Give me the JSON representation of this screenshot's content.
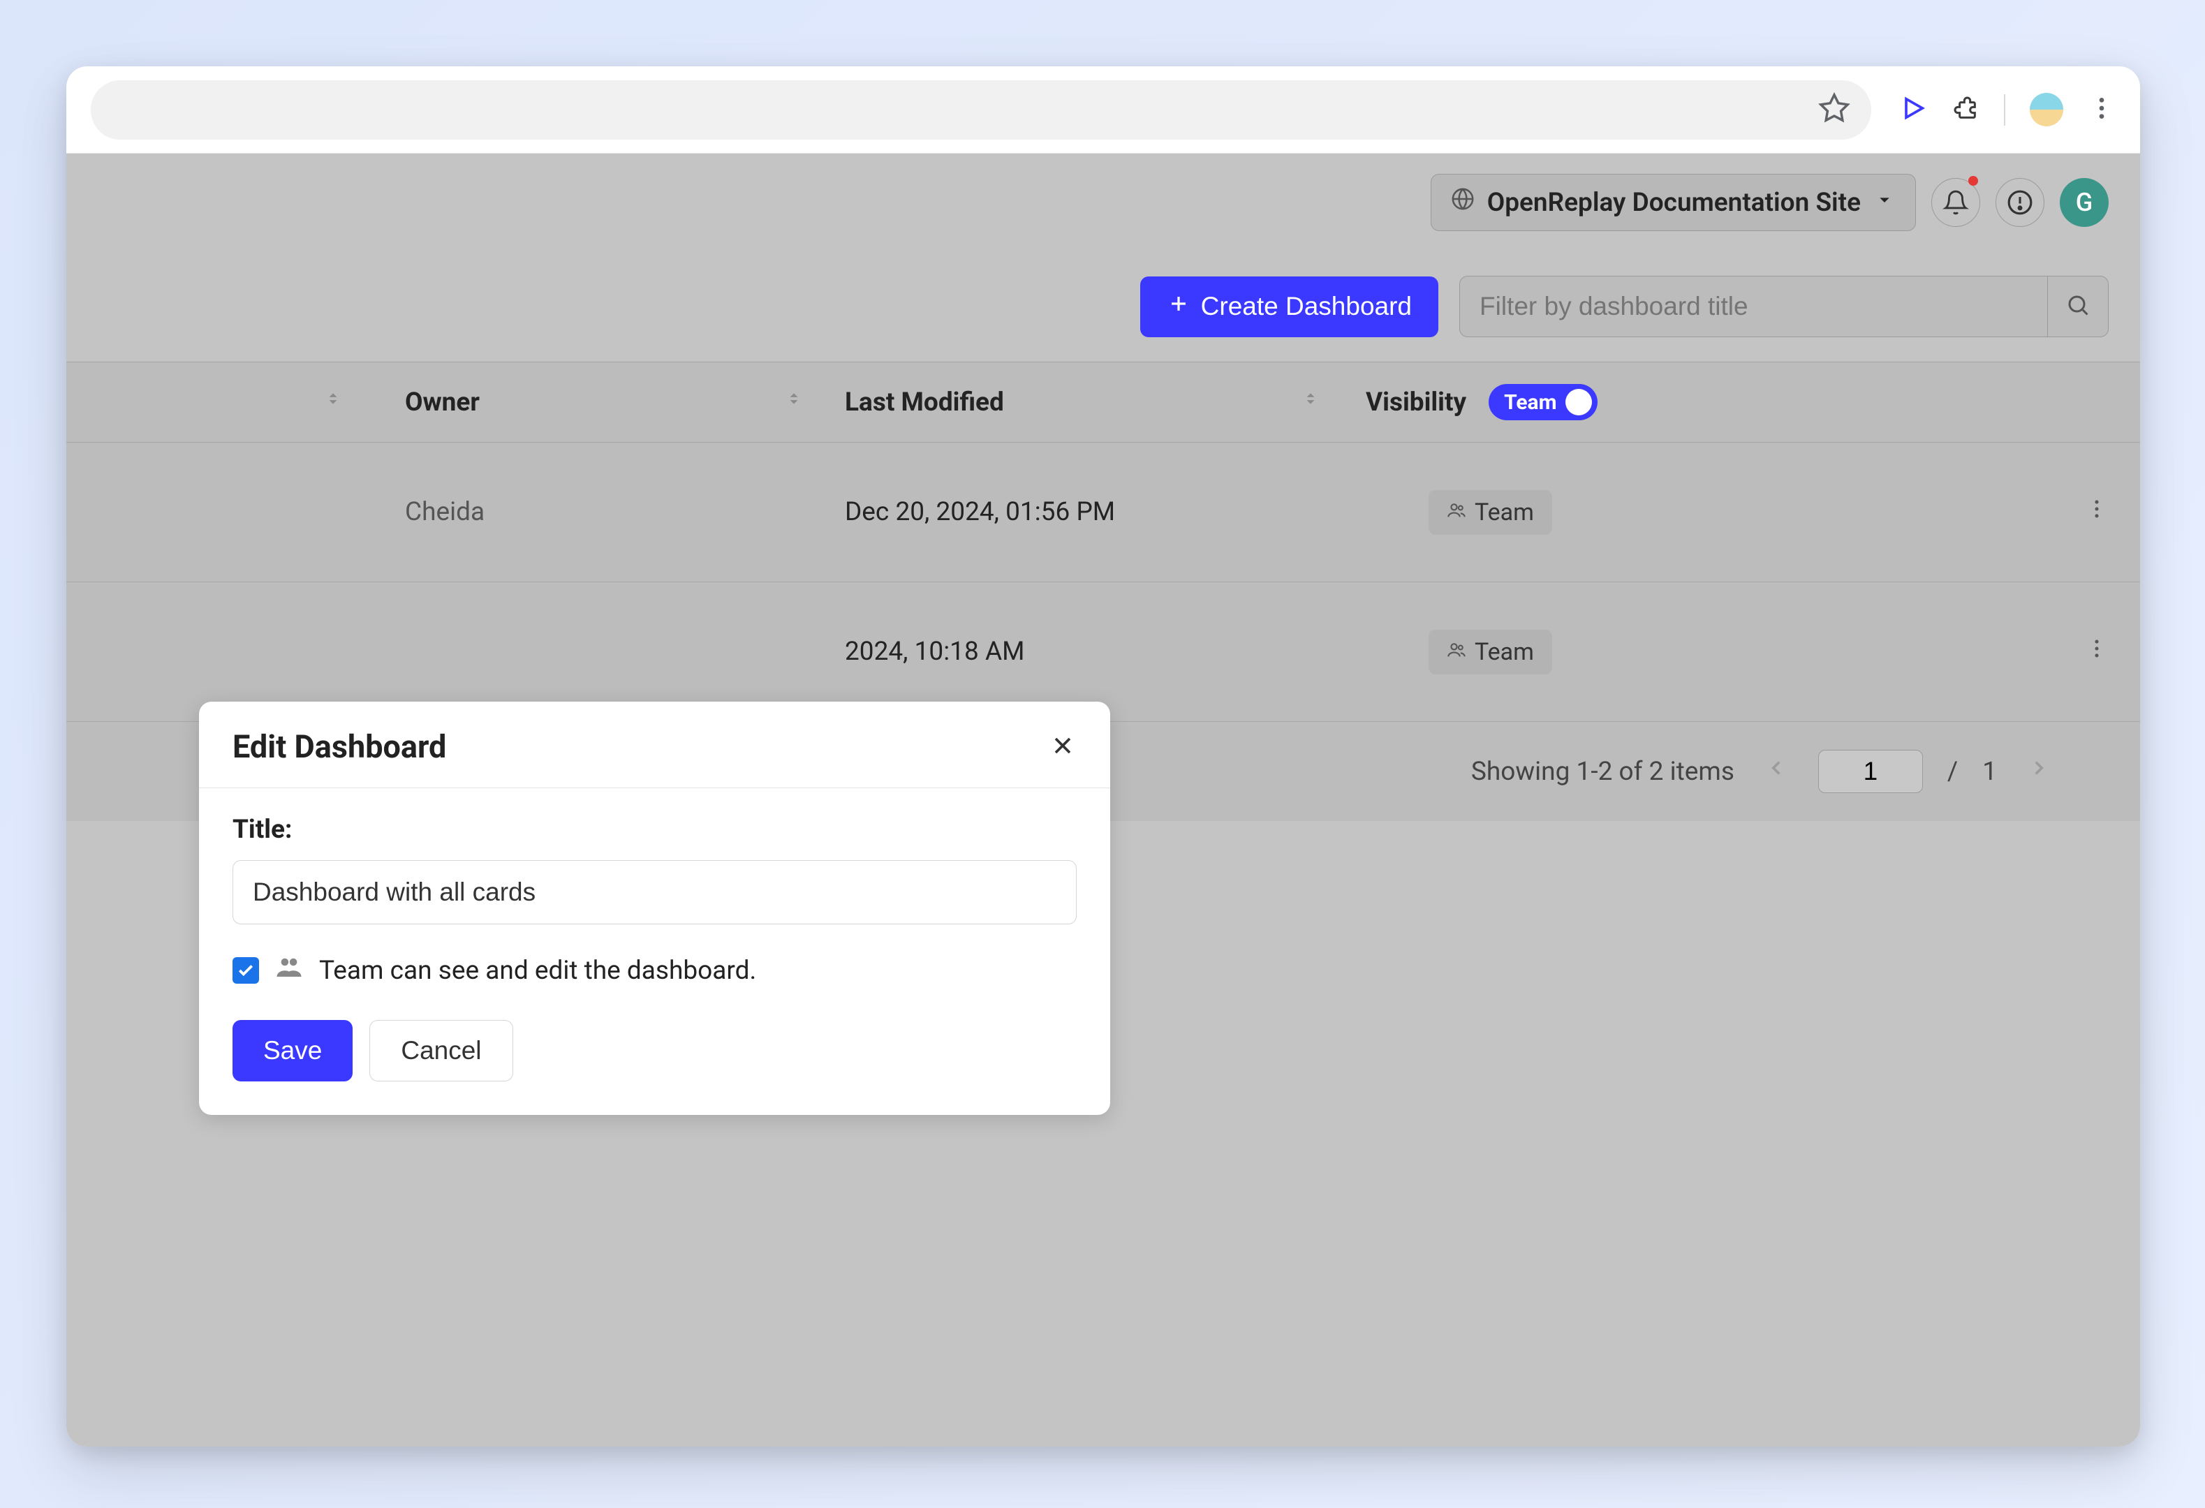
{
  "browser": {
    "star": "star",
    "play": "play",
    "ext": "extension",
    "menu": "menu"
  },
  "header": {
    "project_selector": "OpenReplay Documentation Site",
    "user_initial": "G"
  },
  "toolbar": {
    "create_label": "Create Dashboard",
    "search_placeholder": "Filter by dashboard title"
  },
  "table": {
    "columns": {
      "owner": "Owner",
      "last_modified": "Last Modified",
      "visibility": "Visibility"
    },
    "visibility_toggle": "Team",
    "rows": [
      {
        "owner": "Cheida",
        "last_modified": "Dec 20, 2024, 01:56 PM",
        "visibility": "Team"
      },
      {
        "owner": "",
        "last_modified": "2024, 10:18 AM",
        "visibility": "Team"
      }
    ]
  },
  "pagination": {
    "summary": "Showing 1-2 of 2 items",
    "page_value": "1",
    "separator": "/",
    "total_pages": "1"
  },
  "modal": {
    "title": "Edit Dashboard",
    "field_label": "Title:",
    "title_value": "Dashboard with all cards",
    "team_edit_label": "Team can see and edit the dashboard.",
    "save_label": "Save",
    "cancel_label": "Cancel"
  }
}
